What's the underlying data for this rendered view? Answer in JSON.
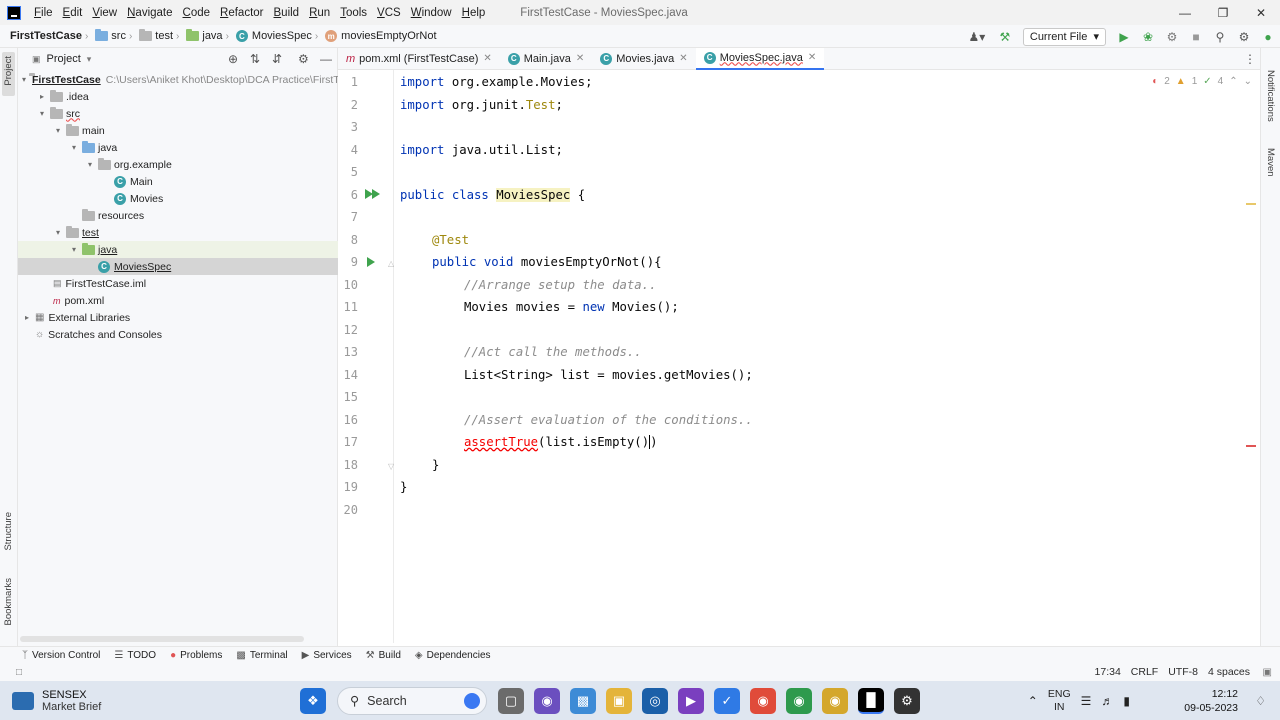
{
  "menu": {
    "items": [
      "File",
      "Edit",
      "View",
      "Navigate",
      "Code",
      "Refactor",
      "Build",
      "Run",
      "Tools",
      "VCS",
      "Window",
      "Help"
    ],
    "window_title": "FirstTestCase - MoviesSpec.java"
  },
  "breadcrumb": {
    "items": [
      "FirstTestCase",
      "src",
      "test",
      "java",
      "MoviesSpec",
      "moviesEmptyOrNot"
    ]
  },
  "toolbar": {
    "run_config": "Current File"
  },
  "project_panel": {
    "title": "Project",
    "rows": [
      {
        "label": "FirstTestCase",
        "extra": "C:\\Users\\Aniket Khot\\Desktop\\DCA Practice\\FirstT"
      },
      {
        "label": ".idea"
      },
      {
        "label": "src"
      },
      {
        "label": "main"
      },
      {
        "label": "java"
      },
      {
        "label": "org.example"
      },
      {
        "label": "Main"
      },
      {
        "label": "Movies"
      },
      {
        "label": "resources"
      },
      {
        "label": "test"
      },
      {
        "label": "java"
      },
      {
        "label": "MoviesSpec"
      },
      {
        "label": "FirstTestCase.iml"
      },
      {
        "label": "pom.xml"
      },
      {
        "label": "External Libraries"
      },
      {
        "label": "Scratches and Consoles"
      }
    ]
  },
  "tabs": [
    {
      "label": "pom.xml (FirstTestCase)"
    },
    {
      "label": "Main.java"
    },
    {
      "label": "Movies.java"
    },
    {
      "label": "MoviesSpec.java"
    }
  ],
  "inspections": {
    "errors": "2",
    "warnings": "1",
    "ok": "4"
  },
  "code": {
    "line_numbers": [
      "1",
      "2",
      "3",
      "4",
      "5",
      "6",
      "7",
      "8",
      "9",
      "10",
      "11",
      "12",
      "13",
      "14",
      "15",
      "16",
      "17",
      "18",
      "19",
      "20"
    ],
    "l1_kw": "import",
    "l1_rest": " org.example.Movies;",
    "l2_kw": "import",
    "l2_rest": " org.junit.",
    "l2_test": "Test",
    "l2_end": ";",
    "l4_kw": "import",
    "l4_rest": " java.util.List;",
    "l6_kw": "public class ",
    "l6_cls": "MoviesSpec",
    "l6_rest": " {",
    "l8_ann": "@Test",
    "l9_kw": "public void ",
    "l9_rest": "moviesEmptyOrNot(){",
    "l10": "//Arrange setup the data..",
    "l11_a": "Movies movies = ",
    "l11_kw": "new",
    "l11_b": " Movies();",
    "l13": "//Act call the methods..",
    "l14": "List<String> list = movies.getMovies();",
    "l16": "//Assert evaluation of the conditions..",
    "l17_err": "assertTrue",
    "l17_rest": "(list.isEmpty()",
    "l17_end": ")",
    "l18": "}",
    "l19": "}"
  },
  "bottom_tools": [
    "Version Control",
    "TODO",
    "Problems",
    "Terminal",
    "Services",
    "Build",
    "Dependencies"
  ],
  "status": {
    "position": "17:34",
    "line_sep": "CRLF",
    "encoding": "UTF-8",
    "indent": "4 spaces"
  },
  "side_labels": {
    "project": "Project",
    "structure": "Structure",
    "bookmarks": "Bookmarks",
    "notifications": "Notifications",
    "maven": "Maven"
  },
  "taskbar": {
    "widget_title": "SENSEX",
    "widget_sub": "Market Brief",
    "search": "Search",
    "lang": "ENG",
    "region": "IN",
    "time": "12:12",
    "date": "09-05-2023"
  }
}
